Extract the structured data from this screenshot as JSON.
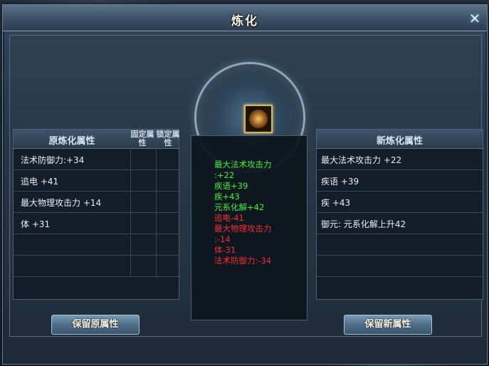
{
  "window": {
    "title": "炼化"
  },
  "left_panel": {
    "header": "原炼化属性",
    "col_fixed": "固定属性",
    "col_locked": "锁定属性",
    "rows": [
      "法术防御力:+34",
      "追电 +41",
      "最大物理攻击力 +14",
      "体 +31",
      "",
      ""
    ]
  },
  "middle_panel": {
    "lines": [
      {
        "text": "最大法术攻击力",
        "color": "green"
      },
      {
        "text": ":+22",
        "color": "green"
      },
      {
        "text": "疾语+39",
        "color": "green"
      },
      {
        "text": "疾+43",
        "color": "green"
      },
      {
        "text": "元系化解+42",
        "color": "green"
      },
      {
        "text": "追电-41",
        "color": "red"
      },
      {
        "text": "最大物理攻击力",
        "color": "red"
      },
      {
        "text": ":-14",
        "color": "red"
      },
      {
        "text": "体-31",
        "color": "red"
      },
      {
        "text": "法术防御力:-34",
        "color": "red"
      }
    ]
  },
  "right_panel": {
    "header": "新炼化属性",
    "rows": [
      "最大法术攻击力 +22",
      "疾语 +39",
      "疾 +43",
      "御元: 元系化解上升42",
      "",
      ""
    ]
  },
  "buttons": {
    "keep_original": "保留原属性",
    "keep_new": "保留新属性"
  }
}
